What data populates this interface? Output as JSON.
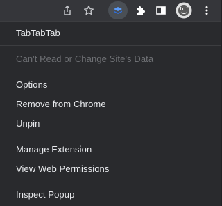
{
  "toolbar": {
    "icons": [
      "share-icon",
      "star-icon",
      "tabtabtab-extension-icon",
      "puzzle-icon",
      "side-panel-icon",
      "profile-avatar",
      "more-vert-icon"
    ]
  },
  "menu": {
    "header": "TabTabTab",
    "site_data": "Can't Read or Change Site's Data",
    "options": "Options",
    "remove": "Remove from Chrome",
    "unpin": "Unpin",
    "manage": "Manage Extension",
    "permissions": "View Web Permissions",
    "inspect": "Inspect Popup"
  },
  "colors": {
    "background": "#292a2d",
    "text": "#e8eaed",
    "disabled_text": "#6f7175",
    "extension_blue": "#3b82f6"
  }
}
